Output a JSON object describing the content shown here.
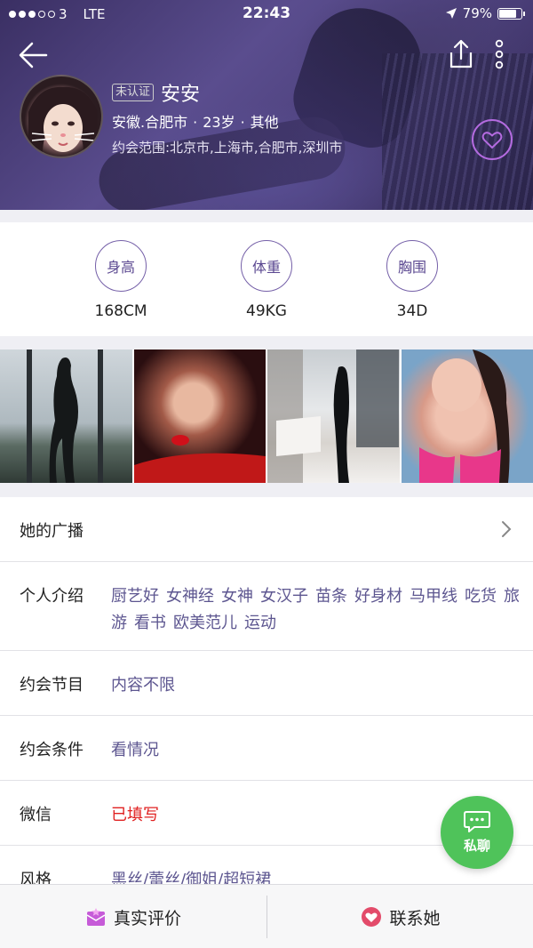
{
  "status_bar": {
    "carrier": "3",
    "network": "LTE",
    "time": "22:43",
    "battery": "79%",
    "battery_level": 0.79
  },
  "profile": {
    "verified_badge": "未认证",
    "name": "安安",
    "location": "安徽.合肥市",
    "age": "23岁",
    "occupation": "其他",
    "dating_range": "约会范围:北京市,上海市,合肥市,深圳市"
  },
  "stats": [
    {
      "label": "身高",
      "value": "168CM"
    },
    {
      "label": "体重",
      "value": "49KG"
    },
    {
      "label": "胸围",
      "value": "34D"
    }
  ],
  "rows": {
    "broadcast": {
      "label": "她的广播"
    },
    "intro": {
      "label": "个人介绍",
      "tags": [
        "厨艺好",
        "女神经",
        "女神",
        "女汉子",
        "苗条",
        "好身材",
        "马甲线",
        "吃货",
        "旅游",
        "看书",
        "欧美范儿",
        "运动"
      ]
    },
    "program": {
      "label": "约会节目",
      "value": "内容不限"
    },
    "condition": {
      "label": "约会条件",
      "value": "看情况"
    },
    "wechat": {
      "label": "微信",
      "value": "已填写"
    },
    "style": {
      "label": "风格",
      "value": "黑丝/蕾丝/御姐/超短裙"
    }
  },
  "chat_button": {
    "label": "私聊"
  },
  "bottom_bar": {
    "review_label": "真实评价",
    "contact_label": "联系她"
  },
  "colors": {
    "accent_purple": "#5d5690",
    "chat_green": "#4fc35a",
    "wechat_red": "#e02020",
    "fav_purple": "#b46be0"
  }
}
